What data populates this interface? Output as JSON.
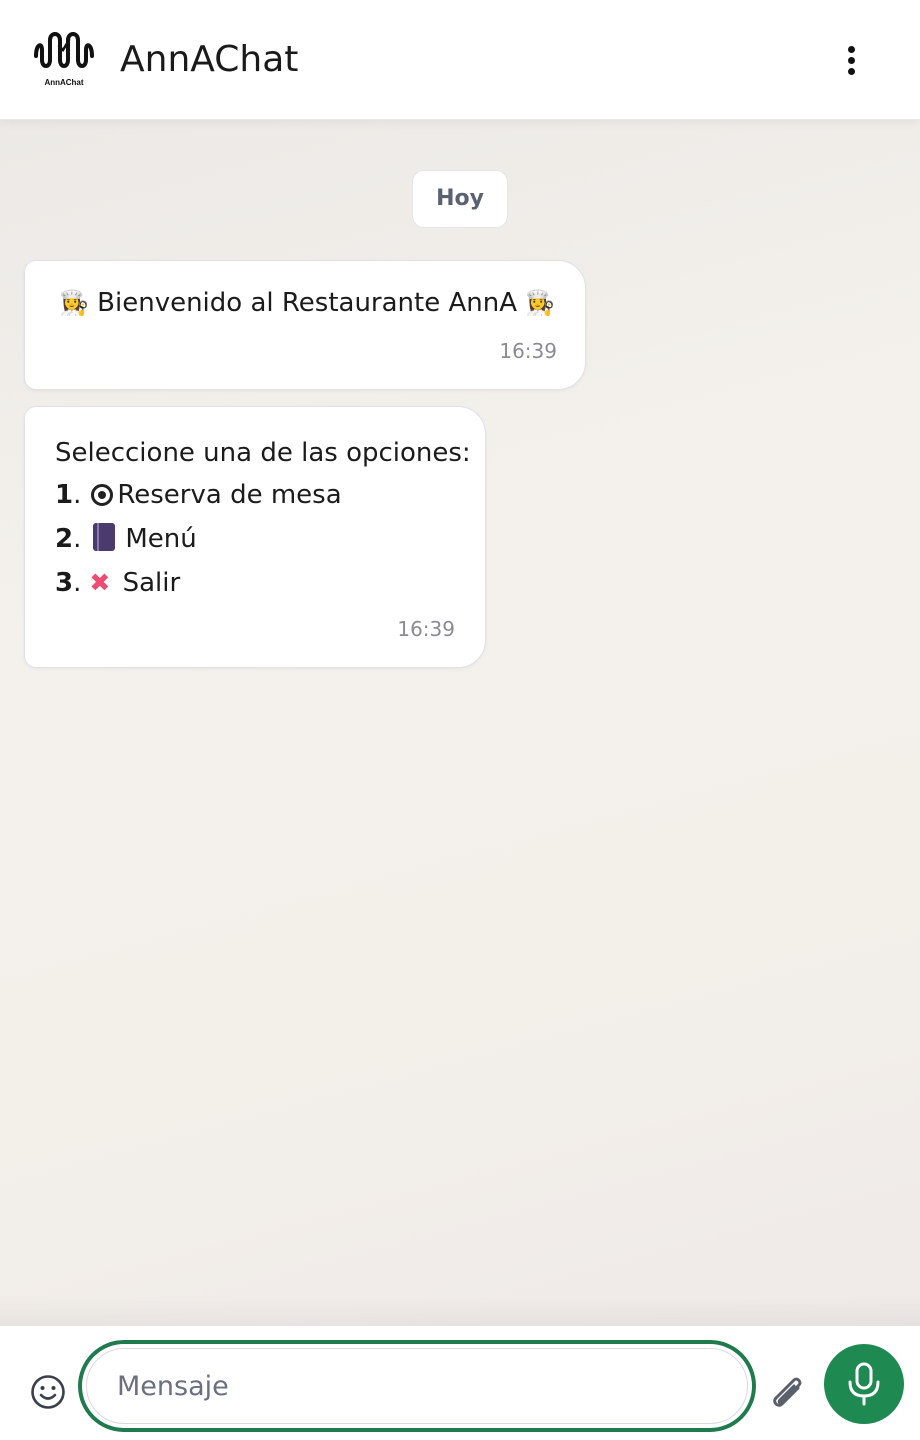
{
  "header": {
    "logo_caption": "AnnAChat",
    "title": "AnnAChat",
    "menu_icon": "more-vertical-icon"
  },
  "chat": {
    "date_label": "Hoy",
    "messages": [
      {
        "text": "Bienvenido al Restaurante AnnA",
        "leading_emoji": "👩‍🍳",
        "trailing_emoji": "👩‍🍳",
        "time": "16:39"
      },
      {
        "intro": "Seleccione una de las opciones:",
        "options": [
          {
            "number": "1",
            "icon": "plate-icon",
            "label": "Reserva de mesa"
          },
          {
            "number": "2",
            "icon": "book-icon",
            "label": "Menú"
          },
          {
            "number": "3",
            "icon": "cross-mark-icon",
            "label": "Salir"
          }
        ],
        "time": "16:39"
      }
    ]
  },
  "composer": {
    "placeholder": "Mensaje",
    "emoji_icon": "smiley-icon",
    "attach_icon": "paperclip-icon",
    "mic_icon": "microphone-icon"
  },
  "colors": {
    "accent": "#1e8a52",
    "input_border": "#1f7a4d",
    "cross": "#ee4c72"
  }
}
